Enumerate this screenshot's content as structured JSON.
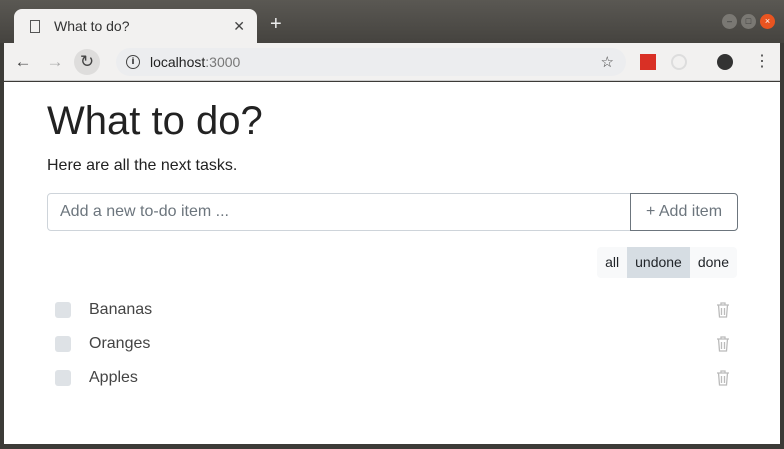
{
  "browser": {
    "tab_title": "What to do?",
    "url_host": "localhost",
    "url_port": ":3000"
  },
  "page": {
    "title": "What to do?",
    "subtitle": "Here are all the next tasks.",
    "input_placeholder": "Add a new to-do item ...",
    "add_label": "+ Add item",
    "filters": [
      {
        "label": "all"
      },
      {
        "label": "undone"
      },
      {
        "label": "done"
      }
    ],
    "active_filter": "undone",
    "items": [
      {
        "label": "Bananas",
        "done": false
      },
      {
        "label": "Oranges",
        "done": false
      },
      {
        "label": "Apples",
        "done": false
      }
    ]
  }
}
